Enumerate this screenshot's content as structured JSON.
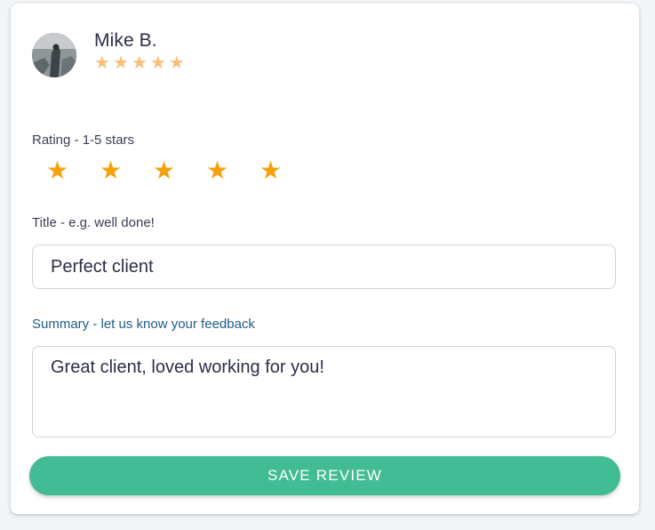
{
  "reviewer": {
    "name": "Mike B.",
    "avatar_icon": "user-photo-avatar",
    "star_rating": 5,
    "star_color": "#f6c07a"
  },
  "form": {
    "rating_label": "Rating - 1-5 stars",
    "rating_value": 5,
    "rating_star_color": "#f5a20a",
    "title_label": "Title - e.g. well done!",
    "title_value": "Perfect client",
    "summary_label": "Summary - let us know your feedback",
    "summary_value": "Great client, loved working for you!",
    "save_label": "SAVE REVIEW"
  },
  "colors": {
    "accent": "#42bc95",
    "summary_label": "#1f5b86"
  }
}
